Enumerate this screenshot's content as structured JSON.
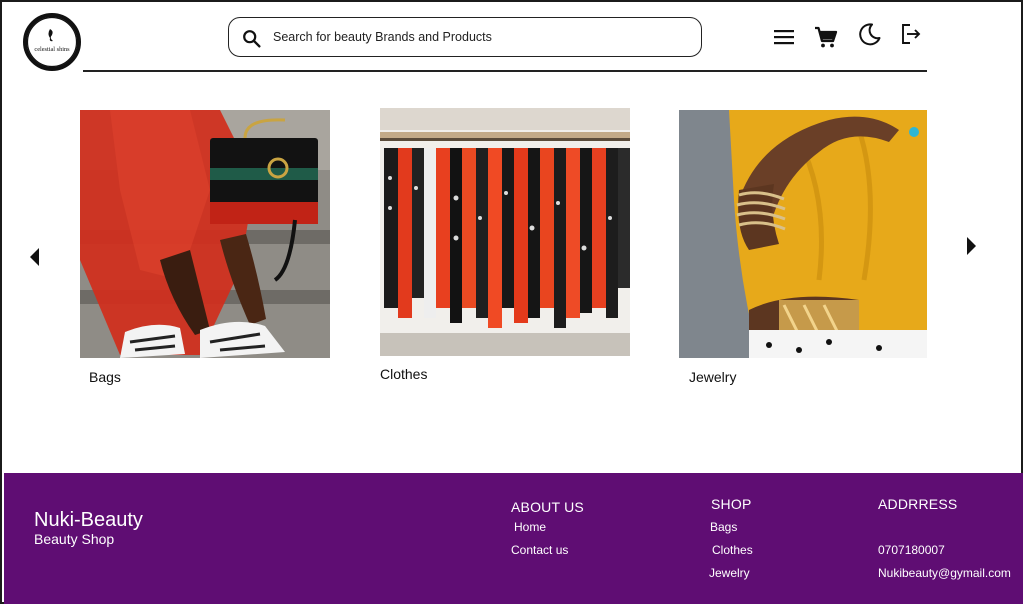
{
  "header": {
    "logo_text": "celestial shins",
    "search_placeholder": "Search for beauty Brands and Products"
  },
  "icons": {
    "search": "search-icon",
    "menu": "hamburger-menu-icon",
    "cart": "shopping-cart-icon",
    "theme": "moon-icon",
    "logout": "logout-icon",
    "prev": "chevron-left-icon",
    "next": "chevron-right-icon"
  },
  "carousel": {
    "items": [
      {
        "label": "Bags"
      },
      {
        "label": "Clothes"
      },
      {
        "label": "Jewelry"
      }
    ]
  },
  "footer": {
    "brand": "Nuki-Beauty",
    "tagline": "Beauty Shop",
    "about": {
      "heading": "ABOUT US",
      "links": [
        "Home",
        "Contact us"
      ]
    },
    "shop": {
      "heading": "SHOP",
      "links": [
        "Bags",
        "Clothes",
        "Jewelry"
      ]
    },
    "address": {
      "heading": "ADDRRESS",
      "phone": "0707180007",
      "email": "Nukibeauty@gymail.com"
    }
  },
  "colors": {
    "footer_bg": "#5f0d73",
    "border": "#1b1b1b"
  }
}
